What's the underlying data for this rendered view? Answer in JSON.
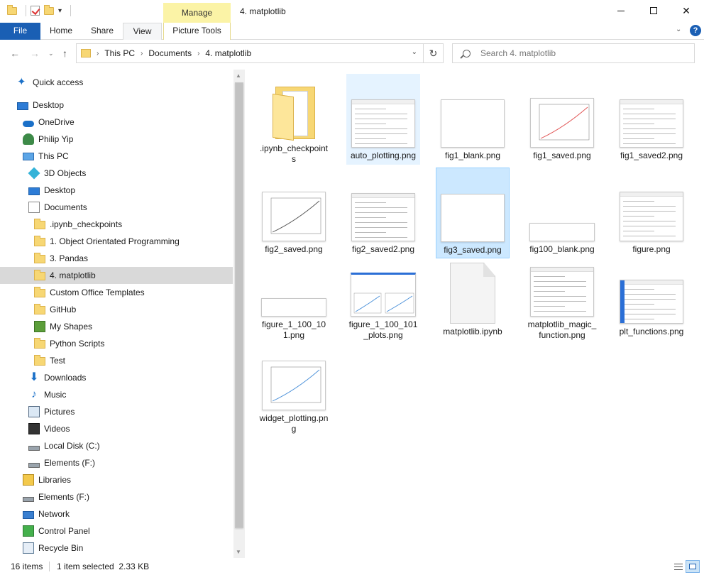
{
  "window": {
    "title": "4. matplotlib",
    "manage_label": "Manage"
  },
  "ribbon": {
    "tabs": [
      "File",
      "Home",
      "Share",
      "View",
      "Picture Tools"
    ],
    "help_label": "?"
  },
  "address": {
    "crumbs": [
      "This PC",
      "Documents",
      "4. matplotlib"
    ],
    "search_placeholder": "Search 4. matplotlib"
  },
  "nav": {
    "items": [
      {
        "label": "Quick access",
        "icon": "star-icon",
        "level": 1
      },
      {
        "label": "Desktop",
        "icon": "desktop-icon",
        "level": 0
      },
      {
        "label": "OneDrive",
        "icon": "cloud-icon",
        "level": 1
      },
      {
        "label": "Philip Yip",
        "icon": "user-icon",
        "level": 1
      },
      {
        "label": "This PC",
        "icon": "computer-icon",
        "level": 1
      },
      {
        "label": "3D Objects",
        "icon": "cube-icon",
        "level": 2
      },
      {
        "label": "Desktop",
        "icon": "desktop-icon",
        "level": 2
      },
      {
        "label": "Documents",
        "icon": "document-icon",
        "level": 2
      },
      {
        "label": ".ipynb_checkpoints",
        "icon": "folder-icon",
        "level": 3
      },
      {
        "label": "1. Object Orientated Programming",
        "icon": "folder-icon",
        "level": 3
      },
      {
        "label": "3. Pandas",
        "icon": "folder-icon",
        "level": 3
      },
      {
        "label": "4. matplotlib",
        "icon": "folder-icon",
        "level": 3,
        "selected": true
      },
      {
        "label": "Custom Office Templates",
        "icon": "folder-icon",
        "level": 3
      },
      {
        "label": "GitHub",
        "icon": "folder-icon",
        "level": 3
      },
      {
        "label": "My Shapes",
        "icon": "shapes-icon",
        "level": 3
      },
      {
        "label": "Python Scripts",
        "icon": "folder-icon",
        "level": 3
      },
      {
        "label": "Test",
        "icon": "folder-icon",
        "level": 3
      },
      {
        "label": "Downloads",
        "icon": "download-icon",
        "level": 2
      },
      {
        "label": "Music",
        "icon": "music-icon",
        "level": 2
      },
      {
        "label": "Pictures",
        "icon": "pictures-icon",
        "level": 2
      },
      {
        "label": "Videos",
        "icon": "videos-icon",
        "level": 2
      },
      {
        "label": "Local Disk (C:)",
        "icon": "drive-icon",
        "level": 2
      },
      {
        "label": "Elements (F:)",
        "icon": "drive-icon",
        "level": 2
      },
      {
        "label": "Libraries",
        "icon": "library-icon",
        "level": 1
      },
      {
        "label": "Elements (F:)",
        "icon": "drive-icon",
        "level": 1
      },
      {
        "label": "Network",
        "icon": "network-icon",
        "level": 1
      },
      {
        "label": "Control Panel",
        "icon": "control-panel-icon",
        "level": 1
      },
      {
        "label": "Recycle Bin",
        "icon": "recycle-bin-icon",
        "level": 1
      }
    ]
  },
  "files": [
    {
      "name": ".ipynb_checkpoints",
      "kind": "folder"
    },
    {
      "name": "auto_plotting.png",
      "kind": "screenshot",
      "state": "hover"
    },
    {
      "name": "fig1_blank.png",
      "kind": "blank"
    },
    {
      "name": "fig1_saved.png",
      "kind": "plot",
      "color": "#e05050"
    },
    {
      "name": "fig1_saved2.png",
      "kind": "screenshot"
    },
    {
      "name": "fig2_saved.png",
      "kind": "plot",
      "color": "#555555"
    },
    {
      "name": "fig2_saved2.png",
      "kind": "screenshot"
    },
    {
      "name": "fig3_saved.png",
      "kind": "blank",
      "state": "selected"
    },
    {
      "name": "fig100_blank.png",
      "kind": "wide-blank"
    },
    {
      "name": "figure.png",
      "kind": "code"
    },
    {
      "name": "figure_1_100_101.png",
      "kind": "wide-blank"
    },
    {
      "name": "figure_1_100_101_plots.png",
      "kind": "dual-plot"
    },
    {
      "name": "matplotlib.ipynb",
      "kind": "document"
    },
    {
      "name": "matplotlib_magic_function.png",
      "kind": "code"
    },
    {
      "name": "plt_functions.png",
      "kind": "list"
    },
    {
      "name": "widget_plotting.png",
      "kind": "plot",
      "color": "#4a90d9"
    }
  ],
  "status": {
    "count": "16 items",
    "selection": "1 item selected  2.33 KB"
  },
  "colors": {
    "accent": "#1a5fb4",
    "manage_tab": "#fbf3a6",
    "selected_tile": "#cce8ff",
    "hover_tile": "#e5f3ff",
    "nav_selected": "#d9d9d9"
  }
}
